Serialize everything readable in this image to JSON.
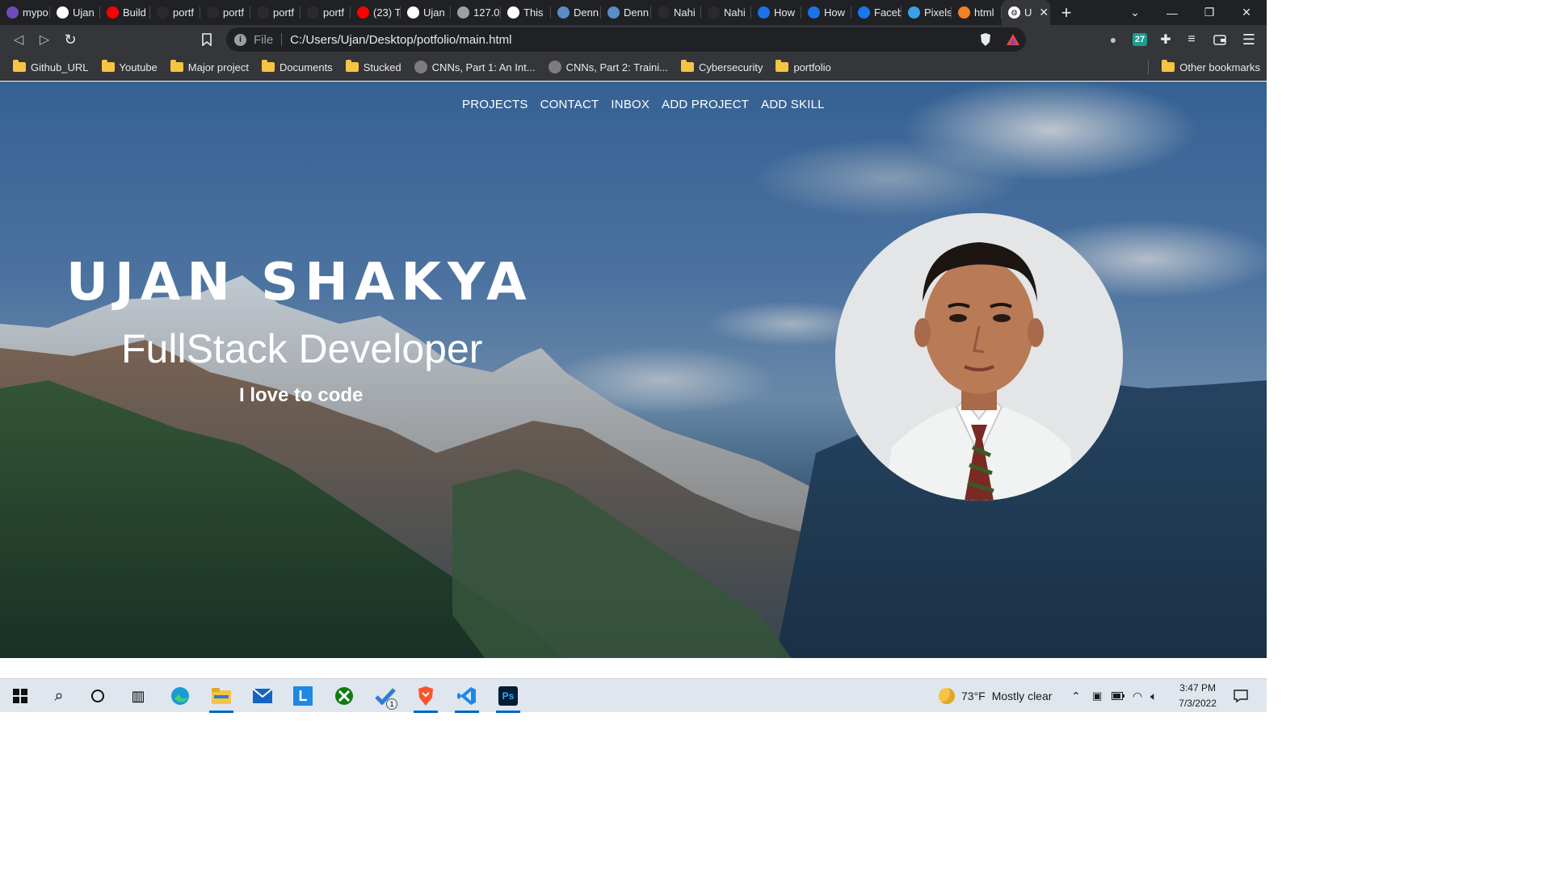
{
  "browser": {
    "tabs": [
      {
        "label": "mypo",
        "icon": "heroku-icon",
        "color": "#6f4bb8"
      },
      {
        "label": "Ujan",
        "icon": "globe-icon",
        "color": "#ffffff"
      },
      {
        "label": "Build",
        "icon": "youtube-icon",
        "color": "#ff0000"
      },
      {
        "label": "portf",
        "icon": "github-icon",
        "color": "#2b2b2b"
      },
      {
        "label": "portf",
        "icon": "github-icon",
        "color": "#2b2b2b"
      },
      {
        "label": "portf",
        "icon": "github-icon",
        "color": "#2b2b2b"
      },
      {
        "label": "portf",
        "icon": "github-icon",
        "color": "#2b2b2b"
      },
      {
        "label": "(23) T",
        "icon": "youtube-icon",
        "color": "#ff0000"
      },
      {
        "label": "Ujan",
        "icon": "globe-icon",
        "color": "#ffffff"
      },
      {
        "label": "127.0",
        "icon": "globe-icon",
        "color": "#9aa0a6"
      },
      {
        "label": "This",
        "icon": "globe-icon",
        "color": "#ffffff"
      },
      {
        "label": "Denn",
        "icon": "site-icon",
        "color": "#5b8cc8"
      },
      {
        "label": "Denn",
        "icon": "site-icon",
        "color": "#5b8cc8"
      },
      {
        "label": "Nahi",
        "icon": "github-icon",
        "color": "#2b2b2b"
      },
      {
        "label": "Nahi",
        "icon": "github-icon",
        "color": "#2b2b2b"
      },
      {
        "label": "How",
        "icon": "site-icon",
        "color": "#1a73e8"
      },
      {
        "label": "How",
        "icon": "refresh-site-icon",
        "color": "#1a73e8"
      },
      {
        "label": "Faceb",
        "icon": "facebook-icon",
        "color": "#1877f2"
      },
      {
        "label": "Pixels",
        "icon": "pixels-icon",
        "color": "#3aa0e8"
      },
      {
        "label": "html",
        "icon": "stackoverflow-icon",
        "color": "#f48024"
      }
    ],
    "active_tab": {
      "label": "U",
      "icon": "globe-icon",
      "close": "✕"
    },
    "new_tab": "+",
    "window_controls": {
      "tab_search": "⌄",
      "minimize": "—",
      "restore": "❐",
      "close": "✕"
    },
    "address": {
      "scheme_label": "File",
      "url": "C:/Users/Ujan/Desktop/potfolio/main.html",
      "info_icon": "i"
    },
    "toolbar_icons": {
      "back": "◁",
      "forward": "▷",
      "reload": "↻",
      "bookmark": "⊓",
      "extensions_badge": "27"
    },
    "bookmarks": [
      {
        "label": "Github_URL",
        "type": "folder"
      },
      {
        "label": "Youtube",
        "type": "folder"
      },
      {
        "label": "Major project",
        "type": "folder"
      },
      {
        "label": "Documents",
        "type": "folder"
      },
      {
        "label": "Stucked",
        "type": "folder"
      },
      {
        "label": "CNNs, Part 1: An Int...",
        "type": "page"
      },
      {
        "label": "CNNs, Part 2: Traini...",
        "type": "page"
      },
      {
        "label": "Cybersecurity",
        "type": "folder"
      },
      {
        "label": "portfolio",
        "type": "folder"
      }
    ],
    "other_bookmarks": "Other bookmarks"
  },
  "page": {
    "nav": [
      "PROJECTS",
      "CONTACT",
      "INBOX",
      "ADD PROJECT",
      "ADD SKILL"
    ],
    "name": "UJAN SHAKYA",
    "role": "FullStack Developer",
    "tagline": "I love to code"
  },
  "taskbar": {
    "apps": [
      "windows-start-icon",
      "search-icon",
      "cortana-icon",
      "task-view-icon",
      "edge-icon",
      "file-explorer-icon",
      "mail-icon",
      "l-app-icon",
      "xbox-icon",
      "todo-icon",
      "brave-icon",
      "vscode-icon",
      "photoshop-icon"
    ],
    "todo_badge": "1",
    "weather": {
      "temp": "73°F",
      "condition": "Mostly clear"
    },
    "time": "3:47 PM",
    "date": "7/3/2022"
  },
  "colors": {
    "accent": "#0067c0",
    "tab_bg": "#202124",
    "toolbar_bg": "#35363a"
  }
}
